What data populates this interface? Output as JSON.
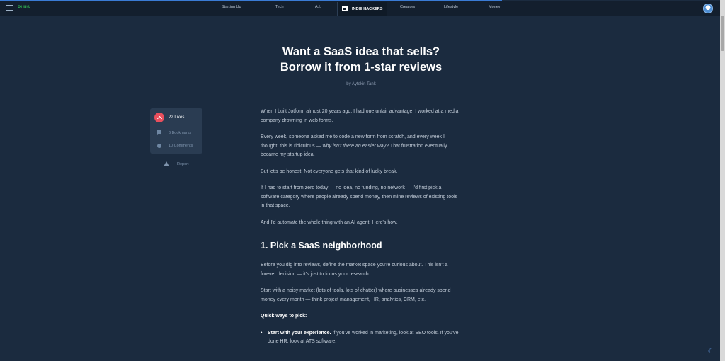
{
  "nav": {
    "brand": "PLUS",
    "items": [
      "Starting Up",
      "Tech",
      "A.I.",
      "INDIE HACKERS",
      "Creators",
      "Lifestyle",
      "Money"
    ],
    "active": "INDIE HACKERS"
  },
  "article": {
    "title_line1": "Want a SaaS idea that sells?",
    "title_line2": "Borrow it from 1-star reviews",
    "author": "by Aytekin Tank",
    "p1": "When I built Jotform almost 20 years ago, I had one unfair advantage: I worked at a media company drowning in web forms.",
    "p2a": "Every week, someone asked me to code a new form from scratch, and every week I thought, this is ridiculous — ",
    "p2em": "why isn't there an easier way?",
    "p2b": " That frustration eventually became my startup idea.",
    "p3": "But let's be honest: Not everyone gets that kind of lucky break.",
    "p4": "If I had to start from zero today — no idea, no funding, no network — I'd first pick a software category where people already spend money, then mine reviews of existing tools in that space.",
    "p5": "And I'd automate the whole thing with an AI agent. Here's how.",
    "h2": "1. Pick a SaaS neighborhood",
    "p6": "Before you dig into reviews, define the market space you're curious about. This isn't a forever decision — it's just to focus your research.",
    "p7": "Start with a noisy market (lots of tools, lots of chatter) where businesses already spend money every month — think project management, HR, analytics, CRM, etc.",
    "p8": "Quick ways to pick:",
    "bullet1_strong": "Start with your experience.",
    "bullet1_rest": " If you've worked in marketing, look at SEO tools. If you've done HR, look at ATS software."
  },
  "side": {
    "likes": "22 Likes",
    "bookmarks": "6 Bookmarks",
    "comments": "10 Comments",
    "report": "Report"
  },
  "colors": {
    "background": "#1b2b3f",
    "accent": "#e94f5d",
    "brand": "#35c759"
  }
}
